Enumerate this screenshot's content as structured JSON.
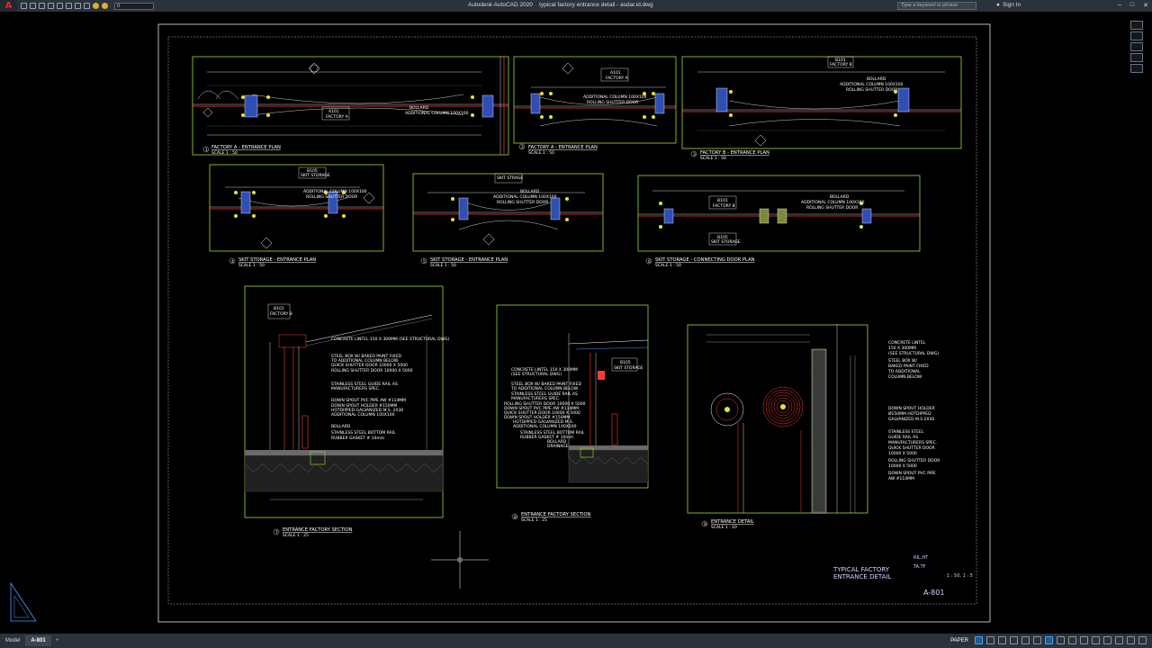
{
  "titlebar": {
    "app_name": "Autodesk AutoCAD 2020",
    "document": "typical factory entrance detail - asdar.id.dwg",
    "workspace_value": "0",
    "search_placeholder": "Type a keyword or phrase",
    "signin": "Sign In"
  },
  "viewports": [
    {
      "title": "FACTORY A - ENTRANCE PLAN",
      "num": "1",
      "scale": "SCALE 1 : 50",
      "room_code": "A101",
      "room_name": "FACTORY A"
    },
    {
      "title": "FACTORY A - ENTRANCE PLAN",
      "num": "2",
      "scale": "SCALE 1 : 50",
      "room_code": "A101",
      "room_name": "FACTORY A"
    },
    {
      "title": "FACTORY B - ENTRANCE PLAN",
      "num": "3",
      "scale": "SCALE 1 : 50",
      "room_code": "B101",
      "room_name": "FACTORY B"
    },
    {
      "title": "SKIT STORAGE - ENTRANCE PLAN",
      "num": "4",
      "scale": "SCALE 1 : 50",
      "room_code": "B105",
      "room_name": "SKIT STORAGE"
    },
    {
      "title": "SKIT STORAGE - ENTRANCE PLAN",
      "num": "5",
      "scale": "SCALE 1 : 50",
      "room_code": "B105",
      "room_name": "SKIT STRAGE"
    },
    {
      "title": "SKIT STORAGE - CONNECTING DOOR PLAN",
      "num": "6",
      "scale": "SCALE 1 : 50",
      "room_code": "B101",
      "room_name": "FACTORY B",
      "room2_code": "B105",
      "room2_name": "SKIT STORAGE"
    },
    {
      "title": "ENTRANCE FACTORY SECTION",
      "num": "7",
      "scale": "SCALE 1 : 25",
      "room_code": "B101",
      "room_name": "FACTORY B"
    },
    {
      "title": "ENTRANCE FACTORY SECTION",
      "num": "8",
      "scale": "SCALE 1 : 25",
      "room_code": "B105",
      "room_name": "SKIT STORAGE"
    },
    {
      "title": "ENTRANCE DETAIL",
      "num": "9",
      "scale": "SCALE 1 : 10"
    }
  ],
  "plan_notes": {
    "bollard": "BOLLARD",
    "column": "ADDITIONAL COLUMN 100X100",
    "shutter": "ROLLING SHUTTER DOOR",
    "rail_guard": "ROLLING SHUTTER GUARD RAIL"
  },
  "section7_notes": [
    "CONCRETE LINTEL 150 X 300MM (SEE STRUCTURAL DWG)",
    "STEEL BOX W/ BAKED PAINT FIXED",
    "TO ADDITIONAL COLUMN BELOW",
    "QUICK SHUTTER DOOR 10000 X 5000",
    "ROLLING SHUTTER DOOR 10000 X 5000",
    "STAINLESS STEEL GUIDE RAIL AS",
    "MANUFACTURERS SPEC.",
    "DOWN SPOUT PVC PIPE AW #114MM",
    "DOWN SPOUT HOLDER #150MM",
    "HOTDIPPED GALVANIZED M.S. 2X30",
    "ADDITIONAL COLUMN 100X100",
    "BOLLARD",
    "STAINLESS STEEL BOTTOM RAIL",
    "RUBBER GASKET # 10mm"
  ],
  "section8_notes": [
    "CONCRETE LINTEL 150 X 300MM",
    "(SEE STRUCTURAL DWG)",
    "STEEL BOX W/ BAKED PAINT FIXED",
    "TO ADDITIONAL COLUMN BELOW",
    "STAINLESS STEEL GUIDE RAIL AS",
    "MANUFACTURERS SPEC.",
    "ROLLING SHUTTER DOOR 10000 X 5000",
    "DOWN SPOUT PVC PIPE AW #114MM",
    "QUICK SHUTTER DOOR 10000 X 5000",
    "DOWN SPOUT HOLDER #150MM",
    "HOTDIPPED GALVANIZED M.S.",
    "ADDITIONAL COLUMN 100X100",
    "STAINLESS STEEL BOTTOM RAIL",
    "RUBBER GASKET # 10mm",
    "BOLLARD",
    "DRAINAGE"
  ],
  "detail9_notes": [
    "CONCRETE LINTEL",
    "150 X 300MM",
    "(SEE STRUCTURAL DWG)",
    "STEEL BOX W/",
    "BAKED PAINT FIXED",
    "TO ADDITIONAL",
    "COLUMN BELOW",
    "DOWN SPOUT HOLDER",
    "Ø150MM HOTDIPPED",
    "GALVANIZED M.S 2X30",
    "STAINLESS STEEL",
    "GUIDE RAIL AS",
    "MANUFACTURERS SPEC.",
    "QUICK SHUTTER DOOR",
    "10000 X 5000",
    "ROLLING SHUTTER DOOR",
    "10000 X 5000",
    "DOWN SPOUT PVC PIPE",
    "AW #114MM"
  ],
  "title_block": {
    "title_line1": "TYPICAL FACTORY",
    "title_line2": "ENTRANCE DETAIL",
    "drawn": "RIL.HT",
    "checked": "TA.TF",
    "scale": "1 : 50, 1 : 5",
    "sheet_no": "A-801"
  },
  "statusbar": {
    "tabs": [
      "Model",
      "A-801"
    ],
    "active_tab": "A-801",
    "add_tab": "+",
    "paper": "PAPER"
  },
  "colors": {
    "background": "#000000",
    "viewport_frame": "#9ddc3a",
    "column_yellow": "#e8e23a",
    "section_red": "#ff3a3a",
    "accent_blue": "#3ea0ff"
  }
}
